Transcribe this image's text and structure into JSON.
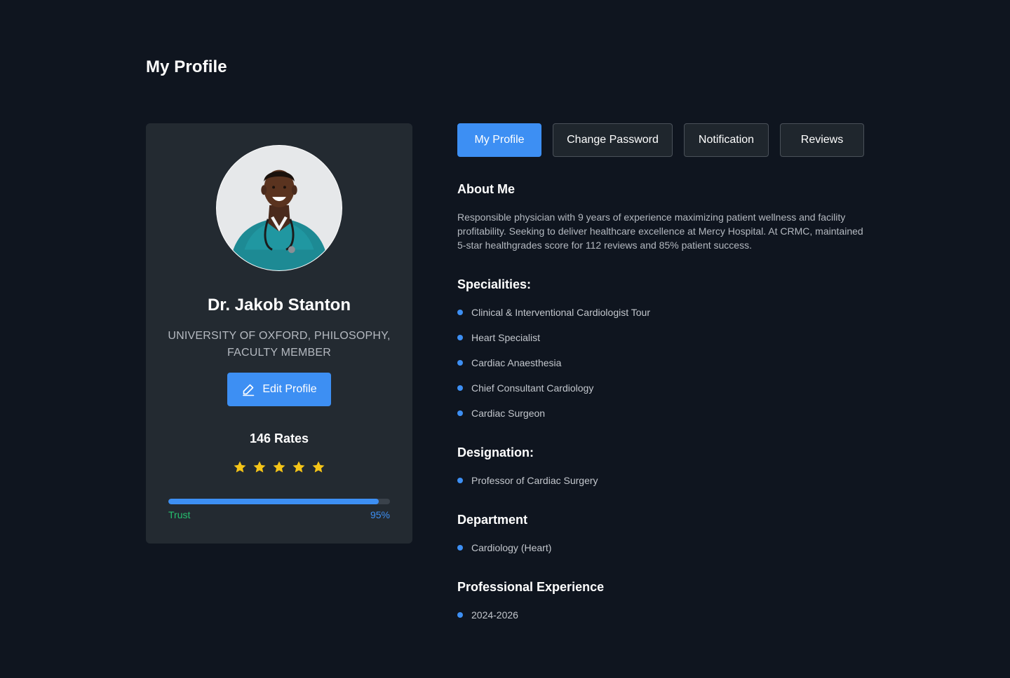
{
  "page": {
    "title": "My Profile"
  },
  "profile": {
    "name": "Dr. Jakob Stanton",
    "affiliation": "UNIVERSITY OF OXFORD, PHILOSOPHY, FACULTY MEMBER",
    "edit_label": "Edit Profile",
    "rates": "146 Rates",
    "star_count": 5,
    "trust_label": "Trust",
    "trust_value": "95%",
    "trust_fraction": 0.95
  },
  "tabs": [
    {
      "label": "My Profile",
      "active": true
    },
    {
      "label": "Change Password",
      "active": false
    },
    {
      "label": "Notification",
      "active": false
    },
    {
      "label": "Reviews",
      "active": false
    }
  ],
  "about": {
    "title": "About Me",
    "text": "Responsible physician with 9 years of experience maximizing patient wellness and facility profitability. Seeking to deliver healthcare excellence at Mercy Hospital. At CRMC, maintained 5-star healthgrades score for 112 reviews and 85% patient success."
  },
  "specialities": {
    "title": "Specialities:",
    "items": [
      "Clinical & Interventional Cardiologist  Tour",
      "Heart Specialist",
      "Cardiac Anaesthesia",
      "Chief Consultant Cardiology",
      "Cardiac Surgeon"
    ]
  },
  "designation": {
    "title": "Designation:",
    "items": [
      "Professor of Cardiac Surgery"
    ]
  },
  "department": {
    "title": "Department",
    "items": [
      "Cardiology (Heart)"
    ]
  },
  "experience": {
    "title": "Professional Experience",
    "items": [
      "2024-2026"
    ]
  },
  "colors": {
    "background": "#0f151f",
    "card": "#232a31",
    "accent": "#3d8ff3",
    "star": "#f5c518",
    "trust_green": "#25c16f"
  },
  "icons": {
    "edit": "pencil-edit-icon",
    "star": "star-icon",
    "bullet": "bullet-dot-icon"
  }
}
